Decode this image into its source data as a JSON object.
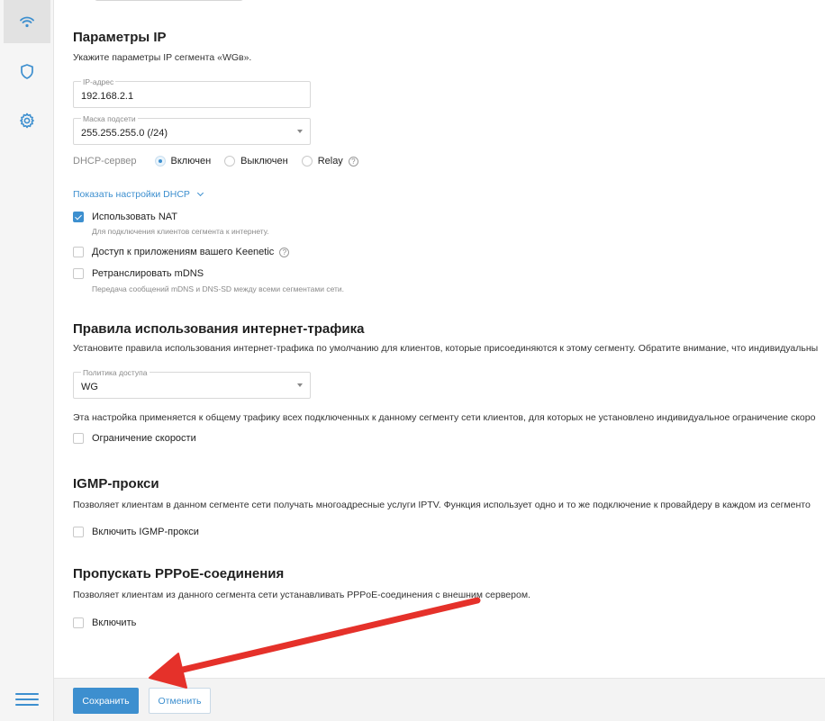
{
  "colors": {
    "accent": "#3d8fcf",
    "arrow": "#e5312a",
    "sidebar": "#f5f5f5"
  },
  "sidebar": {
    "items": [
      {
        "icon": "wifi-icon",
        "active": true
      },
      {
        "icon": "shield-icon",
        "active": false
      },
      {
        "icon": "gear-icon",
        "active": false
      }
    ],
    "menu_icon": "hamburger-menu-icon"
  },
  "ip": {
    "title": "Параметры IP",
    "desc": "Укажите параметры IP сегмента «WGв».",
    "address": {
      "label": "IP-адрес",
      "value": "192.168.2.1"
    },
    "mask": {
      "label": "Маска подсети",
      "value": "255.255.255.0 (/24)"
    },
    "dhcp": {
      "label": "DHCP-сервер",
      "options": [
        "Включен",
        "Выключен",
        "Relay"
      ],
      "selected": "Включен"
    },
    "dhcp_link": "Показать настройки DHCP",
    "nat": {
      "label": "Использовать NAT",
      "sub": "Для подключения клиентов сегмента к интернету.",
      "checked": true
    },
    "apps": {
      "label": "Доступ к приложениям вашего Keenetic",
      "checked": false
    },
    "mdns": {
      "label": "Ретранслировать mDNS",
      "sub": "Передача сообщений mDNS и DNS-SD между всеми сегментами сети.",
      "checked": false
    }
  },
  "traffic": {
    "title": "Правила использования интернет-трафика",
    "desc": "Установите правила использования интернет-трафика по умолчанию для клиентов, которые присоединяются к этому сегменту. Обратите внимание, что индивидуальны",
    "policy": {
      "label": "Политика доступа",
      "value": "WG"
    },
    "note": "Эта настройка применяется к общему трафику всех подключенных к данному сегменту сети клиентов, для которых не установлено индивидуальное ограничение скоро",
    "speed_limit": {
      "label": "Ограничение скорости",
      "checked": false
    }
  },
  "igmp": {
    "title": "IGMP-прокси",
    "desc": "Позволяет клиентам в данном сегменте сети получать многоадресные услуги IPTV. Функция использует одно и то же подключение к провайдеру в каждом из сегменто",
    "enable": {
      "label": "Включить IGMP-прокси",
      "checked": false
    }
  },
  "pppoe": {
    "title": "Пропускать PPPoE-соединения",
    "desc": "Позволяет клиентам из данного сегмента сети устанавливать PPPoE-соединения с внешним сервером.",
    "enable": {
      "label": "Включить",
      "checked": false
    }
  },
  "footer": {
    "save": "Сохранить",
    "cancel": "Отменить"
  }
}
